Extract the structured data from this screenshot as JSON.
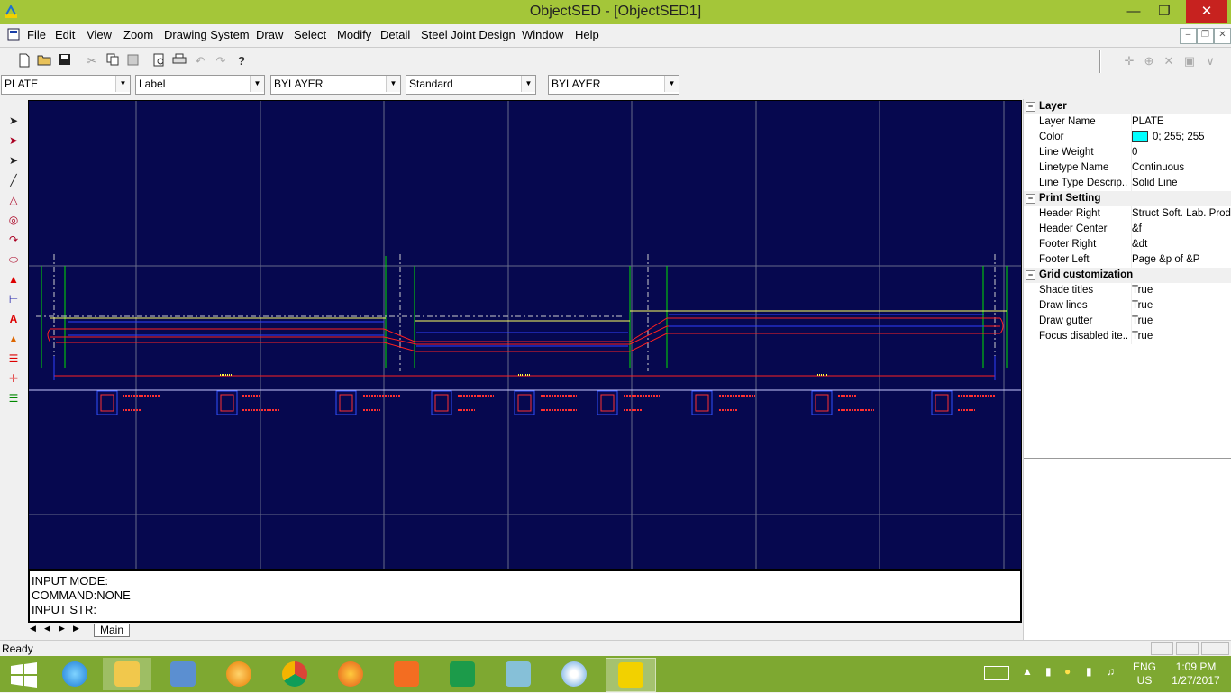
{
  "window": {
    "title": "ObjectSED - [ObjectSED1]"
  },
  "menu": [
    "File",
    "Edit",
    "View",
    "Zoom",
    "Drawing System",
    "Draw",
    "Select",
    "Modify",
    "Detail",
    "Steel Joint Design",
    "Window",
    "Help"
  ],
  "dropdowns": {
    "layer": "PLATE",
    "label": "Label",
    "linetype": "BYLAYER",
    "textstyle": "Standard",
    "lineweight": "BYLAYER"
  },
  "command": {
    "line1": "INPUT MODE:",
    "line2": "COMMAND:NONE",
    "line3": "INPUT STR:"
  },
  "tabs": {
    "main": "Main"
  },
  "properties": {
    "layer": {
      "title": "Layer",
      "rows": [
        {
          "name": "Layer Name",
          "value": "PLATE"
        },
        {
          "name": "Color",
          "value": "0; 255; 255"
        },
        {
          "name": "Line Weight",
          "value": "0"
        },
        {
          "name": "Linetype Name",
          "value": "Continuous"
        },
        {
          "name": "Line Type Descrip...",
          "value": "Solid Line"
        }
      ]
    },
    "print": {
      "title": "Print Setting",
      "rows": [
        {
          "name": "Header Right",
          "value": "Struct Soft. Lab. Prod..."
        },
        {
          "name": "Header Center",
          "value": "&f"
        },
        {
          "name": "Footer Right",
          "value": "&dt"
        },
        {
          "name": "Footer Left",
          "value": "Page &p of &P"
        }
      ]
    },
    "grid": {
      "title": "Grid customization",
      "rows": [
        {
          "name": "Shade titles",
          "value": "True"
        },
        {
          "name": "Draw lines",
          "value": "True"
        },
        {
          "name": "Draw gutter",
          "value": "True"
        },
        {
          "name": "Focus disabled ite...",
          "value": "True"
        }
      ]
    },
    "color_swatch": "#00ffff"
  },
  "status": {
    "text": "Ready"
  },
  "tray": {
    "lang1": "ENG",
    "lang2": "US",
    "time": "1:09 PM",
    "date": "1/27/2017"
  },
  "colors": {
    "titlebar": "#a4c639",
    "canvas": "#06084f",
    "taskbar": "#7ea831"
  }
}
